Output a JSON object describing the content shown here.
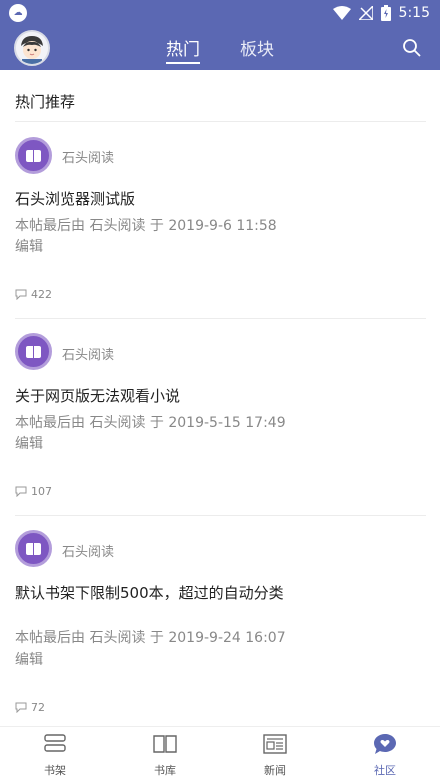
{
  "status_bar": {
    "time": "5:15",
    "app_icon": "cloud-app-icon"
  },
  "header": {
    "tabs": [
      {
        "label": "热门",
        "active": true
      },
      {
        "label": "板块",
        "active": false
      }
    ],
    "accent_color": "#5b68b3"
  },
  "section": {
    "title": "热门推荐"
  },
  "posts": [
    {
      "author": "石头阅读",
      "title": "石头浏览器测试版",
      "meta": "本帖最后由 石头阅读 于 2019-9-6 11:58",
      "edit": "编辑",
      "comments": "422"
    },
    {
      "author": "石头阅读",
      "title": "关于网页版无法观看小说",
      "meta": "本帖最后由 石头阅读 于 2019-5-15 17:49",
      "edit": "编辑",
      "comments": "107"
    },
    {
      "author": "石头阅读",
      "title": "默认书架下限制500本，超过的自动分类",
      "meta": "本帖最后由 石头阅读 于 2019-9-24 16:07",
      "edit": "编辑",
      "comments": "72"
    }
  ],
  "bottom_nav": [
    {
      "label": "书架",
      "icon": "bookshelf-icon"
    },
    {
      "label": "书库",
      "icon": "book-open-icon"
    },
    {
      "label": "新闻",
      "icon": "newspaper-icon"
    },
    {
      "label": "社区",
      "icon": "chat-heart-icon",
      "active": true
    }
  ]
}
